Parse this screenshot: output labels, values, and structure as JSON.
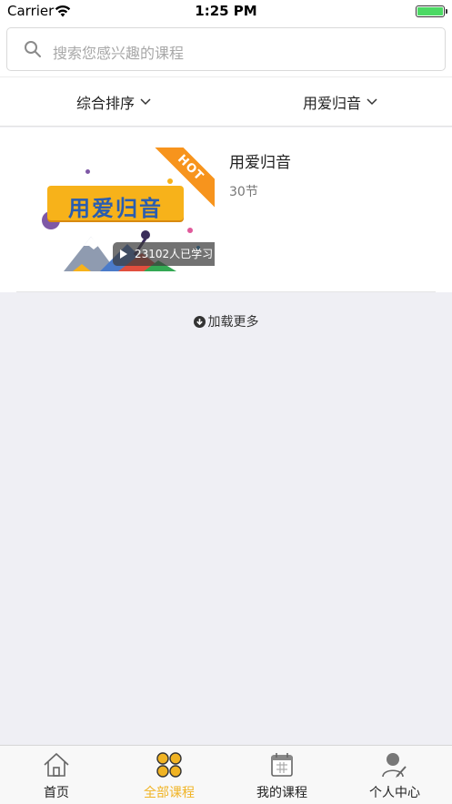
{
  "status_bar": {
    "carrier": "Carrier",
    "time": "1:25 PM",
    "battery_level": 1.0
  },
  "search": {
    "placeholder": "搜索您感兴趣的课程",
    "icon": "search-icon"
  },
  "filters": {
    "sort_label": "综合排序",
    "category_label": "用爱归音"
  },
  "courses": [
    {
      "title": "用爱归音",
      "lessons": "30节",
      "learners": "23102人已学习",
      "hot_badge": "HOT",
      "thumbnail_title": "用爱归音"
    }
  ],
  "load_more": {
    "label": "加载更多",
    "icon": "arrow-down-circle-icon"
  },
  "tabs": [
    {
      "label": "首页",
      "icon": "home-icon",
      "active": false
    },
    {
      "label": "全部课程",
      "icon": "clover-icon",
      "active": true
    },
    {
      "label": "我的课程",
      "icon": "calendar-icon",
      "active": false
    },
    {
      "label": "个人中心",
      "icon": "user-edit-icon",
      "active": false
    }
  ],
  "colors": {
    "accent": "#f0b323",
    "background": "#efeff4",
    "hot_ribbon": "#f7941d"
  }
}
